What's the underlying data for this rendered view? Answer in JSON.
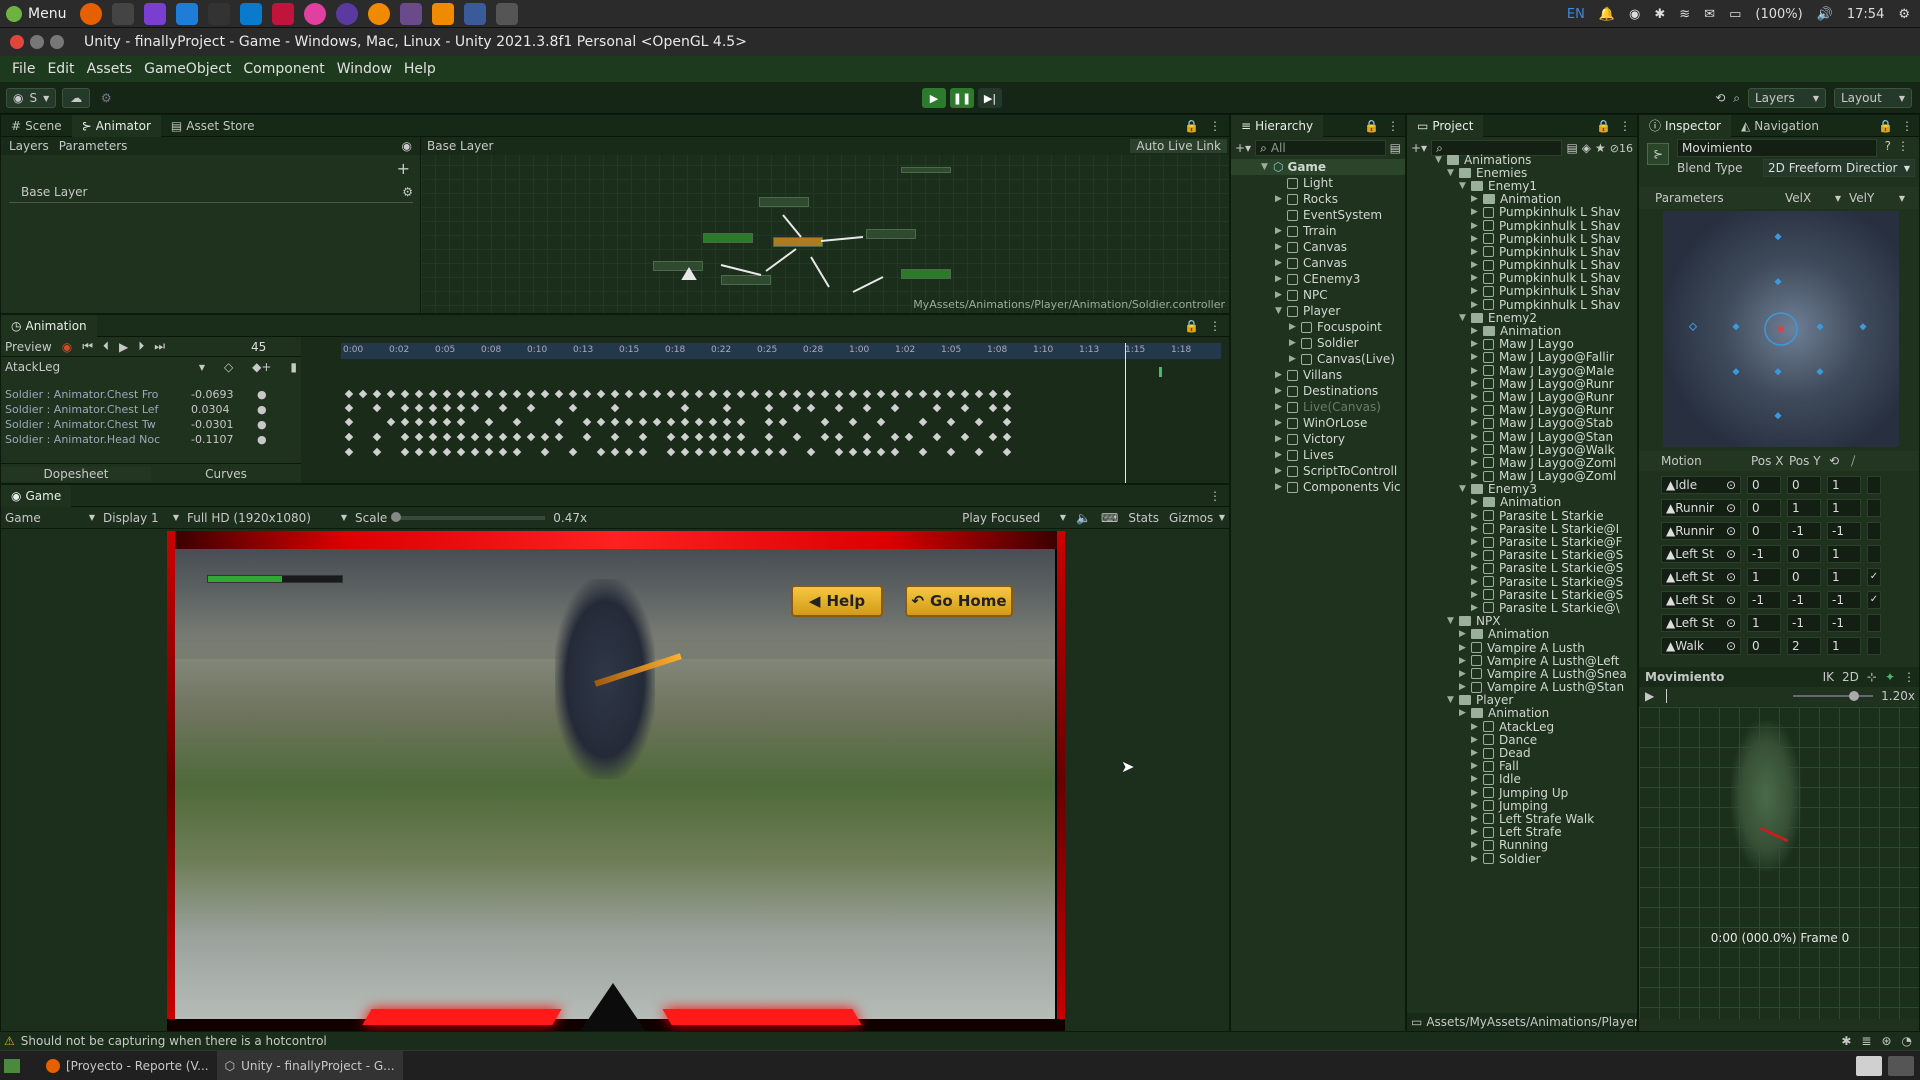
{
  "system_bar": {
    "menu_label": "Menu",
    "lang": "EN",
    "battery": "(100%)",
    "time": "17:54"
  },
  "title": "Unity - finallyProject - Game - Windows, Mac, Linux - Unity 2021.3.8f1 Personal <OpenGL 4.5>",
  "menu": [
    "File",
    "Edit",
    "Assets",
    "GameObject",
    "Component",
    "Window",
    "Help"
  ],
  "toolbar": {
    "account": "S",
    "layers": "Layers",
    "layout": "Layout"
  },
  "scene_tabs": [
    "Scene",
    "Animator",
    "Asset Store"
  ],
  "animator": {
    "sub_tabs": [
      "Layers",
      "Parameters"
    ],
    "breadcrumb": "Base Layer",
    "auto_live_link": "Auto Live Link",
    "layer_name": "Base Layer",
    "path": "MyAssets/Animations/Player/Animation/Soldier.controller"
  },
  "animation": {
    "title": "Animation",
    "preview": "Preview",
    "frame": "45",
    "clip": "AtackLeg",
    "time_labels": [
      "0:00",
      "0:02",
      "0:05",
      "0:08",
      "0:10",
      "0:13",
      "0:15",
      "0:18",
      "0:22",
      "0:25",
      "0:28",
      "1:00",
      "1:02",
      "1:05",
      "1:08",
      "1:10",
      "1:13",
      "1:15",
      "1:18"
    ],
    "properties": [
      {
        "name": "Soldier : Animator.Chest Fro",
        "value": "-0.0693"
      },
      {
        "name": "Soldier : Animator.Chest Lef",
        "value": "0.0304"
      },
      {
        "name": "Soldier : Animator.Chest Tw",
        "value": "-0.0301"
      },
      {
        "name": "Soldier : Animator.Head Noc",
        "value": "-0.1107"
      }
    ],
    "dopesheet": "Dopesheet",
    "curves": "Curves"
  },
  "game": {
    "tab": "Game",
    "view": "Game",
    "display": "Display 1",
    "resolution": "Full HD (1920x1080)",
    "scale_label": "Scale",
    "scale_value": "0.47x",
    "play_focused": "Play Focused",
    "stats": "Stats",
    "gizmos": "Gizmos",
    "help_button": "Help",
    "home_button": "Go Home",
    "health": 0.55
  },
  "hierarchy": {
    "title": "Hierarchy",
    "search_placeholder": "All",
    "root": "Game",
    "items": [
      {
        "label": "Light",
        "indent": 1,
        "dim": false
      },
      {
        "label": "Rocks",
        "indent": 1,
        "dim": false
      },
      {
        "label": "EventSystem",
        "indent": 1,
        "dim": false
      },
      {
        "label": "Trrain",
        "indent": 1,
        "dim": false
      },
      {
        "label": "Canvas",
        "indent": 1,
        "dim": false
      },
      {
        "label": "Canvas",
        "indent": 1,
        "dim": false
      },
      {
        "label": "CEnemy3",
        "indent": 1,
        "dim": false
      },
      {
        "label": "NPC",
        "indent": 1,
        "dim": false
      },
      {
        "label": "Player",
        "indent": 1,
        "dim": false
      },
      {
        "label": "Focuspoint",
        "indent": 2,
        "dim": false
      },
      {
        "label": "Soldier",
        "indent": 2,
        "dim": false
      },
      {
        "label": "Canvas(Live)",
        "indent": 2,
        "dim": false
      },
      {
        "label": "Villans",
        "indent": 1,
        "dim": false
      },
      {
        "label": "Destinations",
        "indent": 1,
        "dim": false
      },
      {
        "label": "Live(Canvas)",
        "indent": 1,
        "dim": true
      },
      {
        "label": "WinOrLose",
        "indent": 1,
        "dim": false
      },
      {
        "label": "Victory",
        "indent": 1,
        "dim": false
      },
      {
        "label": "Lives",
        "indent": 1,
        "dim": false
      },
      {
        "label": "ScriptToControll",
        "indent": 1,
        "dim": false
      },
      {
        "label": "Components Vic",
        "indent": 1,
        "dim": false
      }
    ]
  },
  "project": {
    "title": "Project",
    "count": "16",
    "path": "Assets/MyAssets/Animations/Player/",
    "items": [
      {
        "label": "Animations",
        "indent": 0,
        "folder": true
      },
      {
        "label": "Enemies",
        "indent": 1,
        "folder": true
      },
      {
        "label": "Enemy1",
        "indent": 2,
        "folder": true
      },
      {
        "label": "Animation",
        "indent": 3,
        "folder": true
      },
      {
        "label": "Pumpkinhulk L Shav",
        "indent": 3,
        "folder": false
      },
      {
        "label": "Pumpkinhulk L Shav",
        "indent": 3,
        "folder": false
      },
      {
        "label": "Pumpkinhulk L Shav",
        "indent": 3,
        "folder": false
      },
      {
        "label": "Pumpkinhulk L Shav",
        "indent": 3,
        "folder": false
      },
      {
        "label": "Pumpkinhulk L Shav",
        "indent": 3,
        "folder": false
      },
      {
        "label": "Pumpkinhulk L Shav",
        "indent": 3,
        "folder": false
      },
      {
        "label": "Pumpkinhulk L Shav",
        "indent": 3,
        "folder": false
      },
      {
        "label": "Pumpkinhulk L Shav",
        "indent": 3,
        "folder": false
      },
      {
        "label": "Enemy2",
        "indent": 2,
        "folder": true
      },
      {
        "label": "Animation",
        "indent": 3,
        "folder": true
      },
      {
        "label": "Maw J Laygo",
        "indent": 3,
        "folder": false
      },
      {
        "label": "Maw J Laygo@Fallir",
        "indent": 3,
        "folder": false
      },
      {
        "label": "Maw J Laygo@Male",
        "indent": 3,
        "folder": false
      },
      {
        "label": "Maw J Laygo@Runr",
        "indent": 3,
        "folder": false
      },
      {
        "label": "Maw J Laygo@Runr",
        "indent": 3,
        "folder": false
      },
      {
        "label": "Maw J Laygo@Runr",
        "indent": 3,
        "folder": false
      },
      {
        "label": "Maw J Laygo@Stab",
        "indent": 3,
        "folder": false
      },
      {
        "label": "Maw J Laygo@Stan",
        "indent": 3,
        "folder": false
      },
      {
        "label": "Maw J Laygo@Walk",
        "indent": 3,
        "folder": false
      },
      {
        "label": "Maw J Laygo@Zoml",
        "indent": 3,
        "folder": false
      },
      {
        "label": "Maw J Laygo@Zoml",
        "indent": 3,
        "folder": false
      },
      {
        "label": "Enemy3",
        "indent": 2,
        "folder": true
      },
      {
        "label": "Animation",
        "indent": 3,
        "folder": true
      },
      {
        "label": "Parasite L Starkie",
        "indent": 3,
        "folder": false
      },
      {
        "label": "Parasite L Starkie@I",
        "indent": 3,
        "folder": false
      },
      {
        "label": "Parasite L Starkie@F",
        "indent": 3,
        "folder": false
      },
      {
        "label": "Parasite L Starkie@S",
        "indent": 3,
        "folder": false
      },
      {
        "label": "Parasite L Starkie@S",
        "indent": 3,
        "folder": false
      },
      {
        "label": "Parasite L Starkie@S",
        "indent": 3,
        "folder": false
      },
      {
        "label": "Parasite L Starkie@S",
        "indent": 3,
        "folder": false
      },
      {
        "label": "Parasite L Starkie@\\",
        "indent": 3,
        "folder": false
      },
      {
        "label": "NPX",
        "indent": 1,
        "folder": true
      },
      {
        "label": "Animation",
        "indent": 2,
        "folder": true
      },
      {
        "label": "Vampire A Lusth",
        "indent": 2,
        "folder": false
      },
      {
        "label": "Vampire A Lusth@Left",
        "indent": 2,
        "folder": false
      },
      {
        "label": "Vampire A Lusth@Snea",
        "indent": 2,
        "folder": false
      },
      {
        "label": "Vampire A Lusth@Stan",
        "indent": 2,
        "folder": false
      },
      {
        "label": "Player",
        "indent": 1,
        "folder": true
      },
      {
        "label": "Animation",
        "indent": 2,
        "folder": true
      },
      {
        "label": "AtackLeg",
        "indent": 3,
        "folder": false
      },
      {
        "label": "Dance",
        "indent": 3,
        "folder": false
      },
      {
        "label": "Dead",
        "indent": 3,
        "folder": false
      },
      {
        "label": "Fall",
        "indent": 3,
        "folder": false
      },
      {
        "label": "Idle",
        "indent": 3,
        "folder": false
      },
      {
        "label": "Jumping Up",
        "indent": 3,
        "folder": false
      },
      {
        "label": "Jumping",
        "indent": 3,
        "folder": false
      },
      {
        "label": "Left Strafe Walk",
        "indent": 3,
        "folder": false
      },
      {
        "label": "Left Strafe",
        "indent": 3,
        "folder": false
      },
      {
        "label": "Running",
        "indent": 3,
        "folder": false
      },
      {
        "label": "Soldier",
        "indent": 3,
        "folder": false
      }
    ]
  },
  "inspector": {
    "tabs": [
      "Inspector",
      "Navigation"
    ],
    "name": "Movimiento",
    "blend_type_label": "Blend Type",
    "blend_type": "2D Freeform Directior",
    "parameters_label": "Parameters",
    "param_x": "VelX",
    "param_y": "VelY",
    "motion_header": [
      "Motion",
      "Pos X",
      "Pos Y"
    ],
    "motions": [
      {
        "name": "Idle",
        "x": "0",
        "y": "0",
        "speed": "1",
        "mirror": false
      },
      {
        "name": "Runnir",
        "x": "0",
        "y": "1",
        "speed": "1",
        "mirror": false
      },
      {
        "name": "Runnir",
        "x": "0",
        "y": "-1",
        "speed": "-1",
        "mirror": false
      },
      {
        "name": "Left St",
        "x": "-1",
        "y": "0",
        "speed": "1",
        "mirror": false
      },
      {
        "name": "Left St",
        "x": "1",
        "y": "0",
        "speed": "1",
        "mirror": true
      },
      {
        "name": "Left St",
        "x": "-1",
        "y": "-1",
        "speed": "-1",
        "mirror": true
      },
      {
        "name": "Left St",
        "x": "1",
        "y": "-1",
        "speed": "-1",
        "mirror": false
      },
      {
        "name": "Walk",
        "x": "0",
        "y": "2",
        "speed": "1",
        "mirror": false
      }
    ],
    "preview_title": "Movimiento",
    "preview_ik": "IK",
    "preview_2d": "2D",
    "preview_speed": "1.20x",
    "preview_footer": "0:00 (000.0%) Frame 0"
  },
  "status": {
    "message": "Should not be capturing when there is a hotcontrol"
  },
  "taskbar": {
    "items": [
      "[Proyecto - Reporte (V...",
      "Unity - finallyProject - G..."
    ]
  },
  "colors": {
    "accent_green": "#2d7a2d",
    "panel_bg": "#1e321e",
    "hud_red": "#ff1a1a"
  }
}
